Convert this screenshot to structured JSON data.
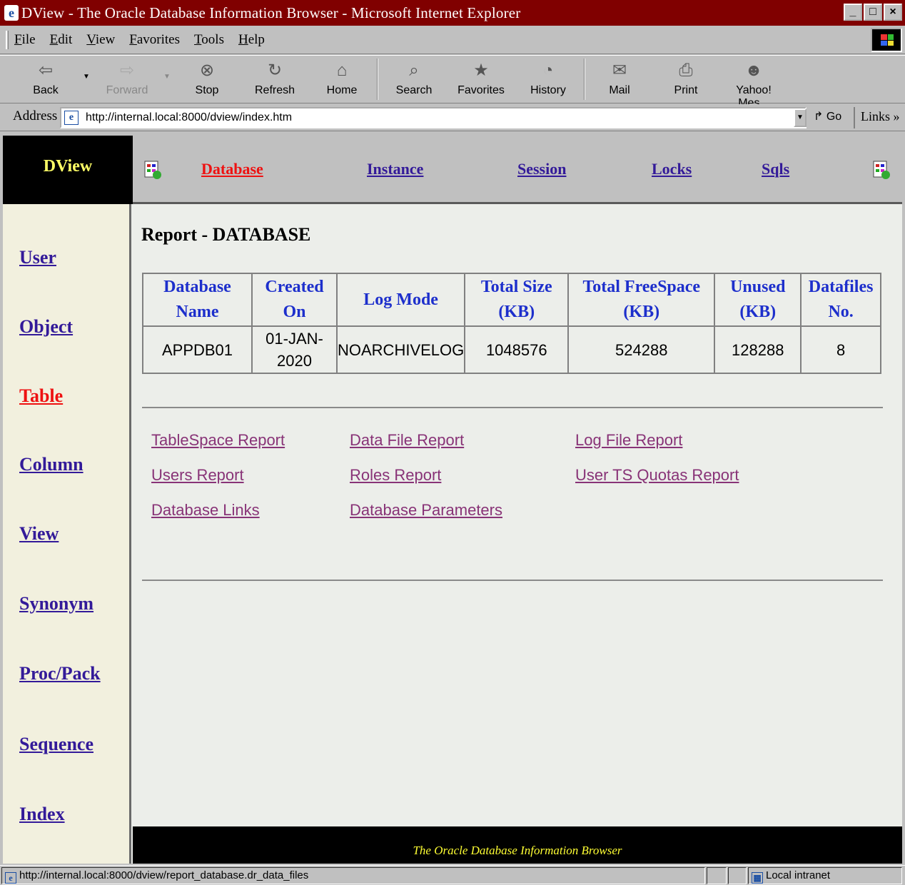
{
  "window": {
    "title": "DView - The Oracle Database Information Browser - Microsoft Internet Explorer",
    "minimize": "_",
    "maximize": "□",
    "close": "×"
  },
  "menu": [
    "File",
    "Edit",
    "View",
    "Favorites",
    "Tools",
    "Help"
  ],
  "toolbar": {
    "back": "Back",
    "forward": "Forward",
    "stop": "Stop",
    "refresh": "Refresh",
    "home": "Home",
    "search": "Search",
    "favorites": "Favorites",
    "history": "History",
    "mail": "Mail",
    "print": "Print",
    "yahoo": "Yahoo! Mes..."
  },
  "address": {
    "label": "Address",
    "url": "http://internal.local:8000/dview/index.htm",
    "go": "Go",
    "links": "Links"
  },
  "app": {
    "brand": "DView",
    "topnav": [
      {
        "label": "Database",
        "active": true
      },
      {
        "label": "Instance",
        "active": false
      },
      {
        "label": "Session",
        "active": false
      },
      {
        "label": "Locks",
        "active": false
      },
      {
        "label": "Sqls",
        "active": false
      }
    ],
    "sidebar": [
      {
        "label": "User",
        "active": false
      },
      {
        "label": "Object",
        "active": false
      },
      {
        "label": "Table",
        "active": true
      },
      {
        "label": "Column",
        "active": false
      },
      {
        "label": "View",
        "active": false
      },
      {
        "label": "Synonym",
        "active": false
      },
      {
        "label": "Proc/Pack",
        "active": false
      },
      {
        "label": "Sequence",
        "active": false
      },
      {
        "label": "Index",
        "active": false
      }
    ],
    "report_title": "Report - DATABASE",
    "table": {
      "headers": [
        [
          "Database",
          "Name"
        ],
        [
          "Created",
          "On"
        ],
        [
          "Log Mode"
        ],
        [
          "Total Size",
          "(KB)"
        ],
        [
          "Total FreeSpace",
          "(KB)"
        ],
        [
          "Unused",
          "(KB)"
        ],
        [
          "Datafiles",
          "No."
        ]
      ],
      "row": {
        "name": "APPDB01",
        "created_line1": "01-JAN-",
        "created_line2": "2020",
        "log_mode": "NOARCHIVELOG",
        "total_size": "1048576",
        "total_free": "524288",
        "unused": "128288",
        "datafiles": "8"
      }
    },
    "report_links": [
      "TableSpace Report",
      "Data File Report",
      "Log File Report",
      "Users Report",
      "Roles Report",
      "User TS Quotas Report",
      "Database Links",
      "Database Parameters"
    ],
    "footer": "The Oracle Database Information Browser"
  },
  "status": {
    "url": "http://internal.local:8000/dview/report_database.dr_data_files",
    "zone": "Local intranet"
  },
  "colors": {
    "titlebar": "#800000",
    "link": "#331a99",
    "active_link": "#ee1111",
    "header_text": "#1d2fcc",
    "report_link": "#883377",
    "footer_text": "#ffff33",
    "brand_text": "#ffff66"
  }
}
